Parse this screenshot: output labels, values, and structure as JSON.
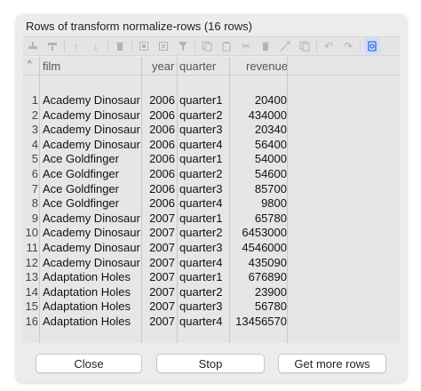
{
  "window": {
    "title": "Rows of transform normalize-rows (16 rows)"
  },
  "toolbar": {
    "icons": [
      "insert-row-icon",
      "delete-row-icon",
      "move-up-icon",
      "move-down-icon",
      "trash-icon",
      "select-icon",
      "clear-selection-icon",
      "filter-icon",
      "copy-icon",
      "paste-icon",
      "cut-icon",
      "trash-small-icon",
      "cut-column-icon",
      "copy-column-icon",
      "undo-icon",
      "redo-icon",
      "refresh-icon"
    ],
    "active_color": "#2e6fe0"
  },
  "table": {
    "columns": [
      "film",
      "year",
      "quarter",
      "revenue"
    ],
    "rows": [
      {
        "idx": "1",
        "film": "Academy Dinosaur",
        "year": "2006",
        "quarter": "quarter1",
        "revenue": "20400"
      },
      {
        "idx": "2",
        "film": "Academy Dinosaur",
        "year": "2006",
        "quarter": "quarter2",
        "revenue": "434000"
      },
      {
        "idx": "3",
        "film": "Academy Dinosaur",
        "year": "2006",
        "quarter": "quarter3",
        "revenue": "20340"
      },
      {
        "idx": "4",
        "film": "Academy Dinosaur",
        "year": "2006",
        "quarter": "quarter4",
        "revenue": "56400"
      },
      {
        "idx": "5",
        "film": "Ace Goldfinger",
        "year": "2006",
        "quarter": "quarter1",
        "revenue": "54000"
      },
      {
        "idx": "6",
        "film": "Ace Goldfinger",
        "year": "2006",
        "quarter": "quarter2",
        "revenue": "54600"
      },
      {
        "idx": "7",
        "film": "Ace Goldfinger",
        "year": "2006",
        "quarter": "quarter3",
        "revenue": "85700"
      },
      {
        "idx": "8",
        "film": "Ace Goldfinger",
        "year": "2006",
        "quarter": "quarter4",
        "revenue": "9800"
      },
      {
        "idx": "9",
        "film": "Academy Dinosaur",
        "year": "2007",
        "quarter": "quarter1",
        "revenue": "65780"
      },
      {
        "idx": "10",
        "film": "Academy Dinosaur",
        "year": "2007",
        "quarter": "quarter2",
        "revenue": "6453000"
      },
      {
        "idx": "11",
        "film": "Academy Dinosaur",
        "year": "2007",
        "quarter": "quarter3",
        "revenue": "4546000"
      },
      {
        "idx": "12",
        "film": "Academy Dinosaur",
        "year": "2007",
        "quarter": "quarter4",
        "revenue": "435090"
      },
      {
        "idx": "13",
        "film": "Adaptation Holes",
        "year": "2007",
        "quarter": "quarter1",
        "revenue": "676890"
      },
      {
        "idx": "14",
        "film": "Adaptation Holes",
        "year": "2007",
        "quarter": "quarter2",
        "revenue": "23900"
      },
      {
        "idx": "15",
        "film": "Adaptation Holes",
        "year": "2007",
        "quarter": "quarter3",
        "revenue": "56780"
      },
      {
        "idx": "16",
        "film": "Adaptation Holes",
        "year": "2007",
        "quarter": "quarter4",
        "revenue": "13456570"
      }
    ]
  },
  "buttons": {
    "close": "Close",
    "stop": "Stop",
    "more": "Get more rows"
  }
}
